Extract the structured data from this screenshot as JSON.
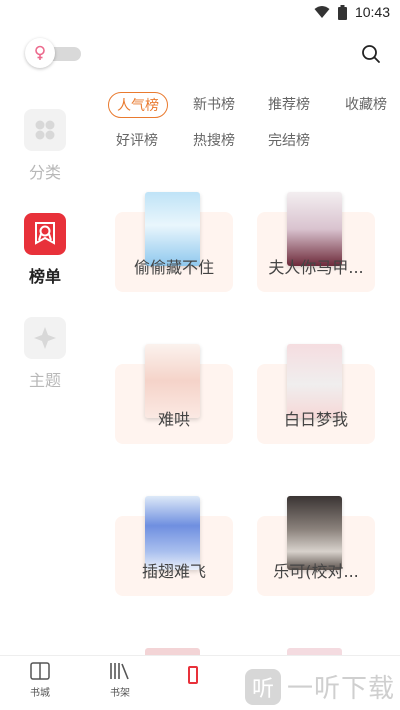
{
  "status_bar": {
    "time": "10:43"
  },
  "header": {
    "gender_icon": "female-icon",
    "search_icon": "search-icon"
  },
  "side_nav": [
    {
      "label": "分类",
      "icon": "grid-icon",
      "active": false
    },
    {
      "label": "榜单",
      "icon": "rank-badge-icon",
      "active": true
    },
    {
      "label": "主题",
      "icon": "theme-icon",
      "active": false
    }
  ],
  "tabs": [
    "人气榜",
    "新书榜",
    "推荐榜",
    "收藏榜",
    "好评榜",
    "热搜榜",
    "完结榜"
  ],
  "active_tab": "人气榜",
  "books": [
    {
      "title": "偷偷藏不住"
    },
    {
      "title": "夫人你马甲..."
    },
    {
      "title": "难哄"
    },
    {
      "title": "白日梦我"
    },
    {
      "title": "插翅难飞"
    },
    {
      "title": "乐可(校对..."
    }
  ],
  "bottom_nav": [
    {
      "label": "书城",
      "icon": "book-open-icon"
    },
    {
      "label": "书架",
      "icon": "bookshelf-icon"
    }
  ],
  "watermark": {
    "logo_text": "听",
    "text": "一听下载"
  },
  "colors": {
    "accent": "#e97a2f",
    "active_side": "#e8313a"
  }
}
